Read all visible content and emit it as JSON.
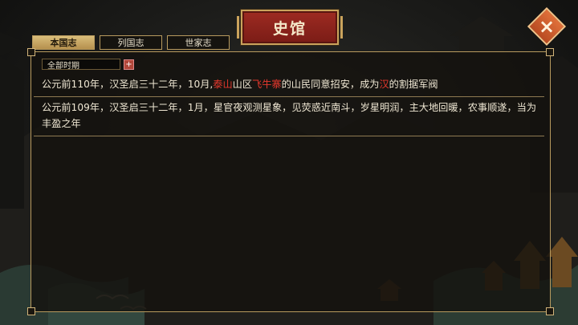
{
  "header": {
    "title": "史馆"
  },
  "close": {
    "glyph": "×"
  },
  "tabs": [
    {
      "label": "本国志",
      "active": true
    },
    {
      "label": "列国志",
      "active": false
    },
    {
      "label": "世家志",
      "active": false
    }
  ],
  "filter": {
    "selected": "全部时期",
    "add_glyph": "+"
  },
  "records": [
    {
      "parts": [
        {
          "text": "公元前110年，汉圣启三十二年，10月,",
          "hl": false
        },
        {
          "text": "泰山",
          "hl": true
        },
        {
          "text": "山区",
          "hl": false
        },
        {
          "text": "飞牛寨",
          "hl": true
        },
        {
          "text": "的山民同意招安，成为",
          "hl": false
        },
        {
          "text": "汉",
          "hl": true
        },
        {
          "text": "的割据军阀",
          "hl": false
        }
      ]
    },
    {
      "parts": [
        {
          "text": "公元前109年，汉圣启三十二年，1月，星官夜观测星象，见荧惑近南斗，岁星明润，主大地回暖，农事顺遂，当为丰盈之年",
          "hl": false
        }
      ]
    }
  ],
  "colors": {
    "accent_red": "#e6382d",
    "gold_border": "#b89a5e",
    "title_red": "#9e2b22"
  }
}
